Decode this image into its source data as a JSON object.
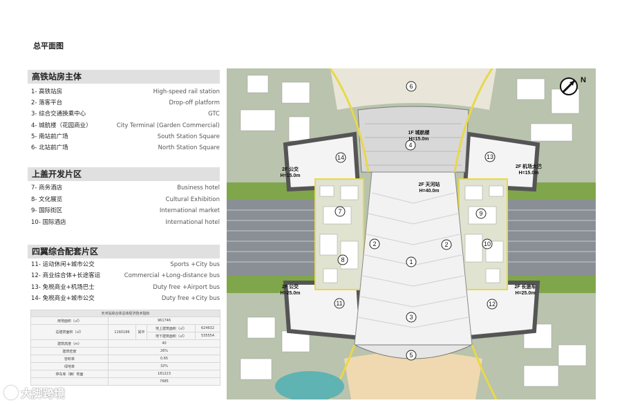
{
  "page_title": "总平面图",
  "sections": [
    {
      "title": "高铁站房主体",
      "items": [
        {
          "cn": "1-  高铁站房",
          "en": "High-speed rail station"
        },
        {
          "cn": "2-  落客平台",
          "en": "Drop-off platform"
        },
        {
          "cn": "3-  综合交通换乘中心",
          "en": "GTC"
        },
        {
          "cn": "4-  城航楼（花园商业）",
          "en": "City Terminal (Garden Commercial)"
        },
        {
          "cn": "5-  南站前广场",
          "en": "South Station Square"
        },
        {
          "cn": "6-  北站前广场",
          "en": "North Station Square"
        }
      ]
    },
    {
      "title": "上盖开发片区",
      "items": [
        {
          "cn": "7-  商务酒店",
          "en": "Business hotel"
        },
        {
          "cn": "8-  文化展览",
          "en": "Cultural Exhibition"
        },
        {
          "cn": "9-  国际街区",
          "en": "International market"
        },
        {
          "cn": "10- 国际酒店",
          "en": "International hotel"
        }
      ]
    },
    {
      "title": "四翼综合配套片区",
      "items": [
        {
          "cn": "11- 运动休闲+城市公交",
          "en": "Sports +City bus"
        },
        {
          "cn": "12- 商业综合体+长途客运",
          "en": "Commercial +Long-distance bus"
        },
        {
          "cn": "13- 免税商业+机场巴士",
          "en": "Duty free +Airport bus"
        },
        {
          "cn": "14- 免税商业+城市公交",
          "en": "Duty free +City bus"
        }
      ]
    }
  ],
  "stats_table": {
    "title": "天河站综合体总体经济技术指标",
    "rows": [
      {
        "label": "用地面积（㎡）",
        "value": "961746"
      },
      {
        "label": "总建筑面积（㎡）",
        "value": "1160186",
        "sub_label": "其中",
        "sub_rows": [
          {
            "label": "地上建筑面积（㎡）",
            "value": "624632"
          },
          {
            "label": "地下建筑面积（㎡）",
            "value": "535554"
          }
        ]
      },
      {
        "label": "建筑高度（m）",
        "value": "40"
      },
      {
        "label": "建筑密度",
        "value": "26%"
      },
      {
        "label": "容积率",
        "value": "0.65"
      },
      {
        "label": "绿地率",
        "value": "32%"
      },
      {
        "label": "停车库（辆）地面",
        "value": "181223"
      },
      {
        "label": "",
        "value": "7685"
      }
    ]
  },
  "map": {
    "north_label": "N",
    "markers": [
      "1",
      "2",
      "2",
      "3",
      "4",
      "5",
      "6",
      "7",
      "8",
      "9",
      "10",
      "11",
      "12",
      "13",
      "14"
    ],
    "labels": {
      "city_terminal_l1": "1F 城航楼",
      "city_terminal_l2": "H=15.0m",
      "tianhe_l1": "2F 天河站",
      "tianhe_l2": "H=40.0m",
      "bus_nw_l1": "2F 公交",
      "bus_nw_l2": "H=15.0m",
      "airport_l1": "2F 机场大巴",
      "airport_l2": "H=15.0m",
      "bus_sw_l1": "2F 公交",
      "bus_sw_l2": "H=25.0m",
      "longbus_l1": "2F 长途车",
      "longbus_l2": "H=25.0m"
    }
  },
  "watermark": "大脚跨境",
  "colors": {
    "header_bg": "#e0e0e0",
    "green": "#7fa64a",
    "rail": "#8a8f96",
    "roof": "#f2f2f2",
    "road_yellow": "#e8d84a"
  }
}
